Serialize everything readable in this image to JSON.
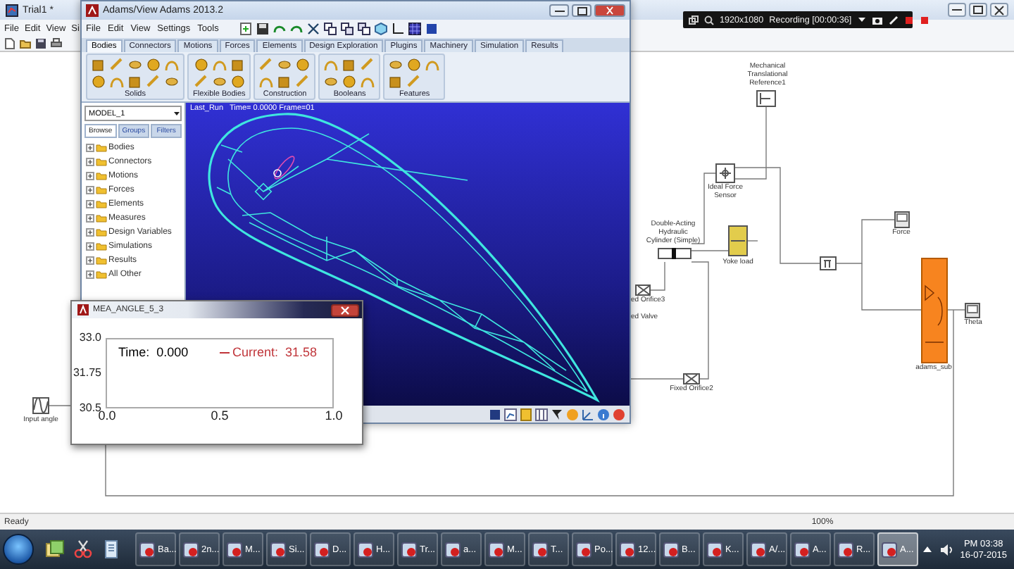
{
  "simulink_window": {
    "title": "Trial1 *",
    "menu": [
      "File",
      "Edit",
      "View",
      "Si"
    ],
    "blocks": [
      {
        "kind": "reference",
        "label": "Mechanical Translational Reference1"
      },
      {
        "kind": "sensor",
        "label": "Ideal Force Sensor"
      },
      {
        "kind": "cylinder",
        "label": "Double-Acting Hydraulic Cylinder (Simple)"
      },
      {
        "kind": "load",
        "label": "Yoke load"
      },
      {
        "kind": "scope",
        "label": "Force"
      },
      {
        "kind": "product"
      },
      {
        "kind": "orifice",
        "label": "ed Orifice3"
      },
      {
        "kind": "text",
        "label": "ed Valve"
      },
      {
        "kind": "subsystem",
        "label": "adams_sub"
      },
      {
        "kind": "scope",
        "label": "Theta"
      },
      {
        "kind": "orifice",
        "label": "Fixed Orifice2"
      },
      {
        "kind": "source",
        "label": "Input angle"
      }
    ],
    "status": [
      "Ready",
      "100%"
    ]
  },
  "adams_window": {
    "title": "Adams/View Adams 2013.2",
    "menu": [
      "File",
      "Edit",
      "View",
      "Settings",
      "Tools"
    ],
    "tabs": [
      {
        "label": "Bodies",
        "selected": true
      },
      {
        "label": "Connectors",
        "selected": false
      },
      {
        "label": "Motions",
        "selected": false
      },
      {
        "label": "Forces",
        "selected": false
      },
      {
        "label": "Elements",
        "selected": false
      },
      {
        "label": "Design Exploration",
        "selected": false
      },
      {
        "label": "Plugins",
        "selected": false
      },
      {
        "label": "Machinery",
        "selected": false
      },
      {
        "label": "Simulation",
        "selected": false
      },
      {
        "label": "Results",
        "selected": false
      }
    ],
    "groups": [
      "Solids",
      "Flexible Bodies",
      "Construction",
      "Booleans",
      "Features"
    ],
    "model": "MODEL_1",
    "browser_tabs": [
      {
        "label": "Browse",
        "selected": true
      },
      {
        "label": "Groups",
        "selected": false
      },
      {
        "label": "Filters",
        "selected": false
      }
    ],
    "tree": [
      {
        "label": "Bodies",
        "expanded": false
      },
      {
        "label": "Connectors",
        "expanded": false
      },
      {
        "label": "Motions",
        "expanded": false
      },
      {
        "label": "Forces",
        "expanded": false
      },
      {
        "label": "Elements",
        "expanded": false
      },
      {
        "label": "Measures",
        "expanded": false
      },
      {
        "label": "Design Variables",
        "expanded": false
      },
      {
        "label": "Simulations",
        "expanded": false
      },
      {
        "label": "Results",
        "expanded": false
      },
      {
        "label": "All Other",
        "expanded": false
      }
    ],
    "viewport_caption": "Last_Run   Time= 0.0000 Frame=01"
  },
  "plot_window": {
    "title": "MEA_ANGLE_5_3",
    "yticks": [
      "33.0",
      "31.75",
      "30.5"
    ],
    "xticks": [
      "0.0",
      "0.5",
      "1.0"
    ],
    "time": "Time:  0.000",
    "current": "Current:  31.58"
  },
  "recorder_bar": {
    "resolution": "1920x1080",
    "status": "Recording [00:00:36]"
  },
  "taskbar": {
    "items": [
      {
        "label": "Ba...",
        "selected": false
      },
      {
        "label": "2n...",
        "selected": false
      },
      {
        "label": "M...",
        "selected": false
      },
      {
        "label": "Si...",
        "selected": false
      },
      {
        "label": "D...",
        "selected": false
      },
      {
        "label": "H...",
        "selected": false
      },
      {
        "label": "Tr...",
        "selected": false
      },
      {
        "label": "a...",
        "selected": false
      },
      {
        "label": "M...",
        "selected": false
      },
      {
        "label": "T...",
        "selected": false
      },
      {
        "label": "Po...",
        "selected": false
      },
      {
        "label": "12...",
        "selected": false
      },
      {
        "label": "B...",
        "selected": false
      },
      {
        "label": "K...",
        "selected": false
      },
      {
        "label": "A/...",
        "selected": false
      },
      {
        "label": "A...",
        "selected": false
      },
      {
        "label": "R...",
        "selected": false
      },
      {
        "label": "A...",
        "selected": true
      }
    ],
    "clock": {
      "time": "PM 03:38",
      "date": "16-07-2015"
    }
  }
}
